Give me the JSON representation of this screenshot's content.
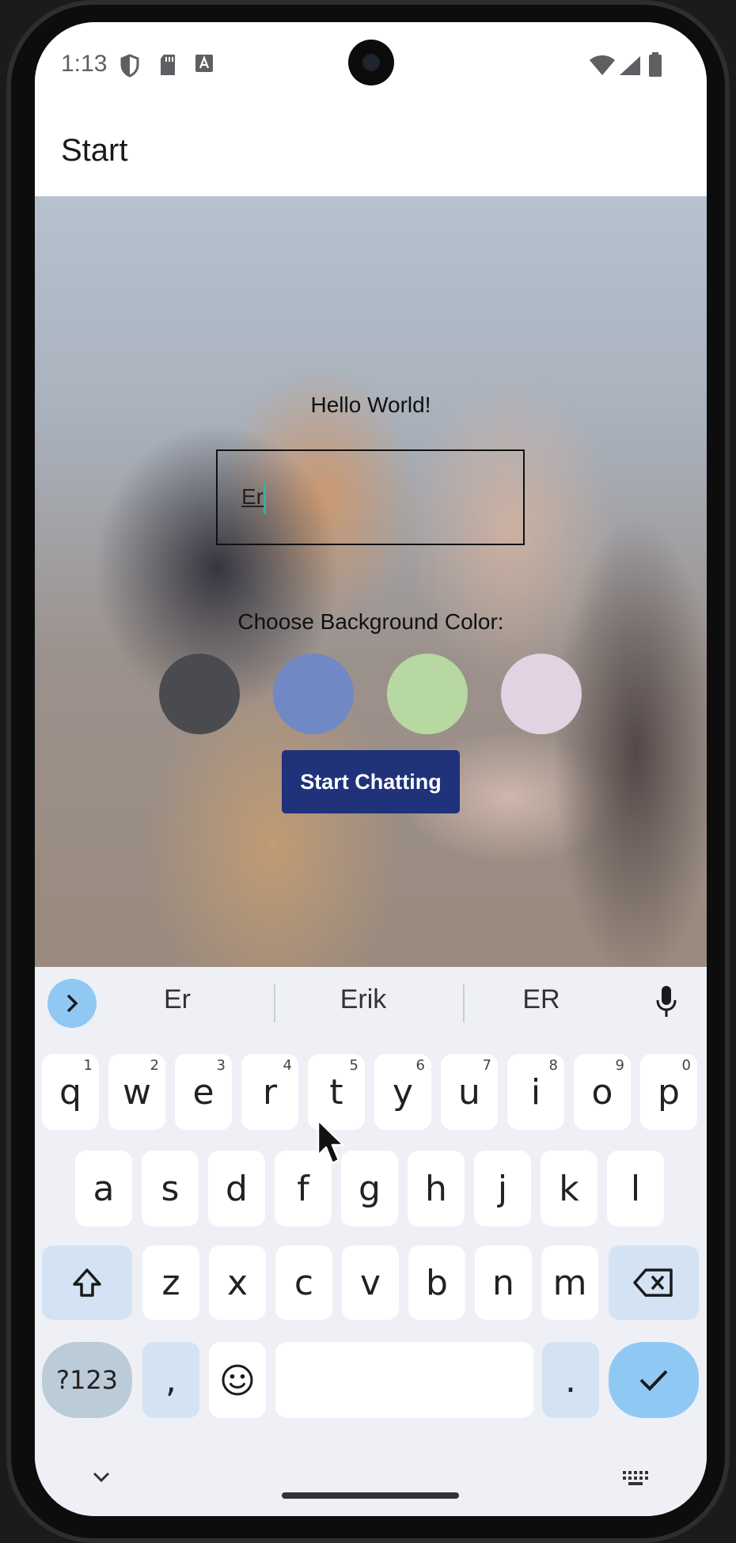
{
  "status_bar": {
    "time": "1:13",
    "left_icons": [
      "shield-icon",
      "sd-card-icon",
      "keyboard-a-icon"
    ],
    "right_icons": [
      "wifi-icon",
      "cell-signal-icon",
      "battery-icon"
    ]
  },
  "app_bar": {
    "title": "Start"
  },
  "main": {
    "greeting": "Hello World!",
    "name_input": {
      "value": "Er"
    },
    "choose_label": "Choose Background Color:",
    "color_options": [
      "#4a4b4f",
      "#7088c4",
      "#b7d8a0",
      "#e2d3e2"
    ],
    "start_button_label": "Start Chatting"
  },
  "keyboard": {
    "suggestions": [
      "Er",
      "Erik",
      "ER"
    ],
    "row1": [
      {
        "k": "q",
        "h": "1"
      },
      {
        "k": "w",
        "h": "2"
      },
      {
        "k": "e",
        "h": "3"
      },
      {
        "k": "r",
        "h": "4"
      },
      {
        "k": "t",
        "h": "5"
      },
      {
        "k": "y",
        "h": "6"
      },
      {
        "k": "u",
        "h": "7"
      },
      {
        "k": "i",
        "h": "8"
      },
      {
        "k": "o",
        "h": "9"
      },
      {
        "k": "p",
        "h": "0"
      }
    ],
    "row2": [
      "a",
      "s",
      "d",
      "f",
      "g",
      "h",
      "j",
      "k",
      "l"
    ],
    "row3": [
      "z",
      "x",
      "c",
      "v",
      "b",
      "n",
      "m"
    ],
    "sym_label": "?123",
    "comma": ",",
    "period": "."
  },
  "colors": {
    "accent": "#1f327a",
    "keyboard_accent": "#8fc9f3",
    "caret": "#2bb5a5"
  }
}
